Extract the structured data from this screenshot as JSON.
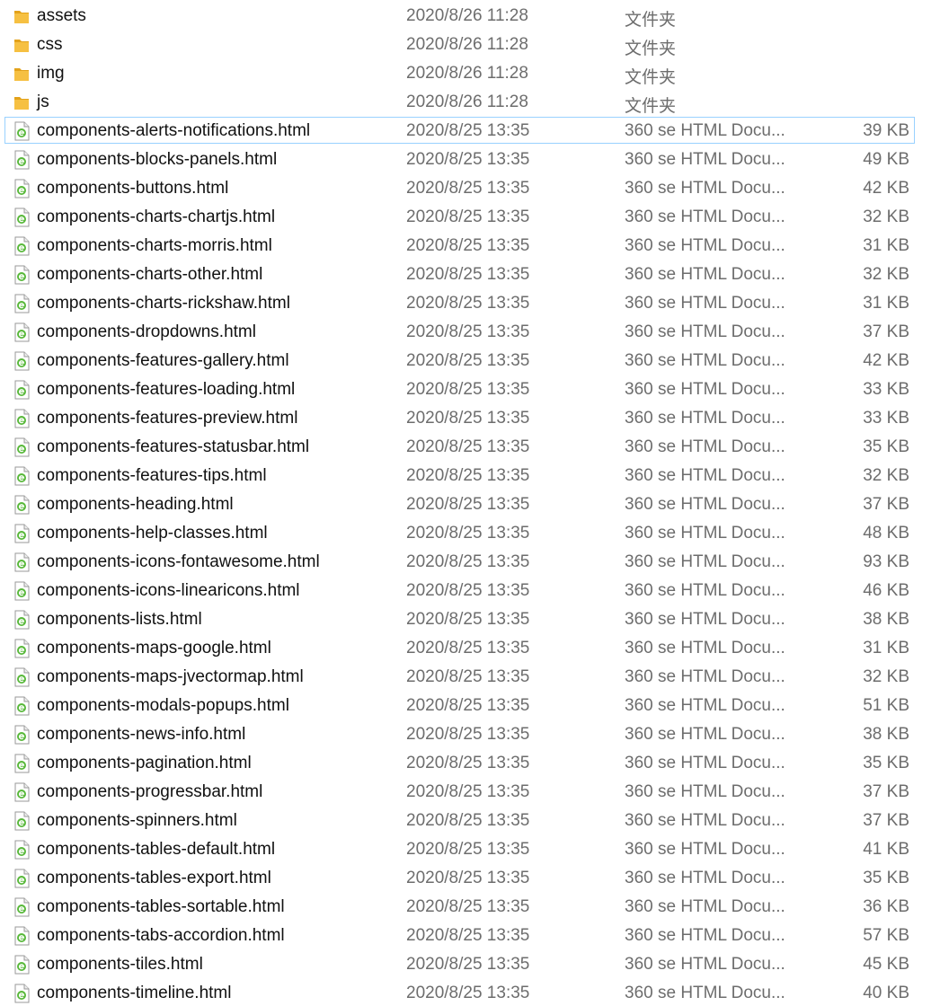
{
  "file_list": {
    "rows": [
      {
        "name": "assets",
        "date": "2020/8/26 11:28",
        "type": "文件夹",
        "size": "",
        "kind": "folder"
      },
      {
        "name": "css",
        "date": "2020/8/26 11:28",
        "type": "文件夹",
        "size": "",
        "kind": "folder"
      },
      {
        "name": "img",
        "date": "2020/8/26 11:28",
        "type": "文件夹",
        "size": "",
        "kind": "folder"
      },
      {
        "name": "js",
        "date": "2020/8/26 11:28",
        "type": "文件夹",
        "size": "",
        "kind": "folder"
      },
      {
        "name": "components-alerts-notifications.html",
        "date": "2020/8/25 13:35",
        "type": "360 se HTML Docu...",
        "size": "39 KB",
        "kind": "html",
        "selected": true
      },
      {
        "name": "components-blocks-panels.html",
        "date": "2020/8/25 13:35",
        "type": "360 se HTML Docu...",
        "size": "49 KB",
        "kind": "html"
      },
      {
        "name": "components-buttons.html",
        "date": "2020/8/25 13:35",
        "type": "360 se HTML Docu...",
        "size": "42 KB",
        "kind": "html"
      },
      {
        "name": "components-charts-chartjs.html",
        "date": "2020/8/25 13:35",
        "type": "360 se HTML Docu...",
        "size": "32 KB",
        "kind": "html"
      },
      {
        "name": "components-charts-morris.html",
        "date": "2020/8/25 13:35",
        "type": "360 se HTML Docu...",
        "size": "31 KB",
        "kind": "html"
      },
      {
        "name": "components-charts-other.html",
        "date": "2020/8/25 13:35",
        "type": "360 se HTML Docu...",
        "size": "32 KB",
        "kind": "html"
      },
      {
        "name": "components-charts-rickshaw.html",
        "date": "2020/8/25 13:35",
        "type": "360 se HTML Docu...",
        "size": "31 KB",
        "kind": "html"
      },
      {
        "name": "components-dropdowns.html",
        "date": "2020/8/25 13:35",
        "type": "360 se HTML Docu...",
        "size": "37 KB",
        "kind": "html"
      },
      {
        "name": "components-features-gallery.html",
        "date": "2020/8/25 13:35",
        "type": "360 se HTML Docu...",
        "size": "42 KB",
        "kind": "html"
      },
      {
        "name": "components-features-loading.html",
        "date": "2020/8/25 13:35",
        "type": "360 se HTML Docu...",
        "size": "33 KB",
        "kind": "html"
      },
      {
        "name": "components-features-preview.html",
        "date": "2020/8/25 13:35",
        "type": "360 se HTML Docu...",
        "size": "33 KB",
        "kind": "html"
      },
      {
        "name": "components-features-statusbar.html",
        "date": "2020/8/25 13:35",
        "type": "360 se HTML Docu...",
        "size": "35 KB",
        "kind": "html"
      },
      {
        "name": "components-features-tips.html",
        "date": "2020/8/25 13:35",
        "type": "360 se HTML Docu...",
        "size": "32 KB",
        "kind": "html"
      },
      {
        "name": "components-heading.html",
        "date": "2020/8/25 13:35",
        "type": "360 se HTML Docu...",
        "size": "37 KB",
        "kind": "html"
      },
      {
        "name": "components-help-classes.html",
        "date": "2020/8/25 13:35",
        "type": "360 se HTML Docu...",
        "size": "48 KB",
        "kind": "html"
      },
      {
        "name": "components-icons-fontawesome.html",
        "date": "2020/8/25 13:35",
        "type": "360 se HTML Docu...",
        "size": "93 KB",
        "kind": "html"
      },
      {
        "name": "components-icons-linearicons.html",
        "date": "2020/8/25 13:35",
        "type": "360 se HTML Docu...",
        "size": "46 KB",
        "kind": "html"
      },
      {
        "name": "components-lists.html",
        "date": "2020/8/25 13:35",
        "type": "360 se HTML Docu...",
        "size": "38 KB",
        "kind": "html"
      },
      {
        "name": "components-maps-google.html",
        "date": "2020/8/25 13:35",
        "type": "360 se HTML Docu...",
        "size": "31 KB",
        "kind": "html"
      },
      {
        "name": "components-maps-jvectormap.html",
        "date": "2020/8/25 13:35",
        "type": "360 se HTML Docu...",
        "size": "32 KB",
        "kind": "html"
      },
      {
        "name": "components-modals-popups.html",
        "date": "2020/8/25 13:35",
        "type": "360 se HTML Docu...",
        "size": "51 KB",
        "kind": "html"
      },
      {
        "name": "components-news-info.html",
        "date": "2020/8/25 13:35",
        "type": "360 se HTML Docu...",
        "size": "38 KB",
        "kind": "html"
      },
      {
        "name": "components-pagination.html",
        "date": "2020/8/25 13:35",
        "type": "360 se HTML Docu...",
        "size": "35 KB",
        "kind": "html"
      },
      {
        "name": "components-progressbar.html",
        "date": "2020/8/25 13:35",
        "type": "360 se HTML Docu...",
        "size": "37 KB",
        "kind": "html"
      },
      {
        "name": "components-spinners.html",
        "date": "2020/8/25 13:35",
        "type": "360 se HTML Docu...",
        "size": "37 KB",
        "kind": "html"
      },
      {
        "name": "components-tables-default.html",
        "date": "2020/8/25 13:35",
        "type": "360 se HTML Docu...",
        "size": "41 KB",
        "kind": "html"
      },
      {
        "name": "components-tables-export.html",
        "date": "2020/8/25 13:35",
        "type": "360 se HTML Docu...",
        "size": "35 KB",
        "kind": "html"
      },
      {
        "name": "components-tables-sortable.html",
        "date": "2020/8/25 13:35",
        "type": "360 se HTML Docu...",
        "size": "36 KB",
        "kind": "html"
      },
      {
        "name": "components-tabs-accordion.html",
        "date": "2020/8/25 13:35",
        "type": "360 se HTML Docu...",
        "size": "57 KB",
        "kind": "html"
      },
      {
        "name": "components-tiles.html",
        "date": "2020/8/25 13:35",
        "type": "360 se HTML Docu...",
        "size": "45 KB",
        "kind": "html"
      },
      {
        "name": "components-timeline.html",
        "date": "2020/8/25 13:35",
        "type": "360 se HTML Docu...",
        "size": "40 KB",
        "kind": "html"
      }
    ]
  },
  "colors": {
    "folder": "#f6c042",
    "folder_dark": "#e3a21a",
    "html_icon_green": "#58b83a",
    "selection_border": "#99d1ff",
    "secondary_text": "#6d6d6d"
  },
  "icons": {
    "folder": "folder-icon",
    "html": "html-file-icon"
  }
}
